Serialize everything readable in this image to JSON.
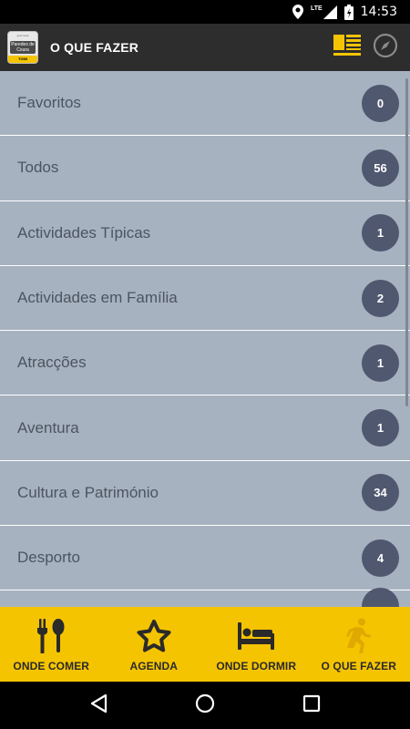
{
  "status_bar": {
    "time": "14:53",
    "network": "LTE",
    "icons": [
      "location-icon",
      "signal-icon",
      "battery-icon"
    ]
  },
  "app_bar": {
    "logo": {
      "top_text": "guia local",
      "mid_text": "Paredes de Coura",
      "bot_text": "TOMI"
    },
    "title": "O QUE FAZER",
    "actions": [
      "list-view-icon",
      "compass-icon"
    ]
  },
  "list": {
    "items": [
      {
        "label": "Favoritos",
        "count": "0"
      },
      {
        "label": "Todos",
        "count": "56"
      },
      {
        "label": "Actividades Típicas",
        "count": "1"
      },
      {
        "label": "Actividades em Família",
        "count": "2"
      },
      {
        "label": "Atracções",
        "count": "1"
      },
      {
        "label": "Aventura",
        "count": "1"
      },
      {
        "label": "Cultura e Património",
        "count": "34"
      },
      {
        "label": "Desporto",
        "count": "4"
      }
    ]
  },
  "bottom_nav": {
    "items": [
      {
        "label": "ONDE COMER",
        "icon": "utensils-icon",
        "active": false
      },
      {
        "label": "AGENDA",
        "icon": "star-icon",
        "active": false
      },
      {
        "label": "ONDE DORMIR",
        "icon": "bed-icon",
        "active": false
      },
      {
        "label": "O QUE FAZER",
        "icon": "running-icon",
        "active": true
      }
    ]
  },
  "colors": {
    "accent": "#f5c400",
    "list_bg": "#a7b2c0",
    "badge": "#505870",
    "app_bar": "#2d2d2d"
  },
  "system_nav": [
    "back-icon",
    "home-icon",
    "recents-icon"
  ]
}
